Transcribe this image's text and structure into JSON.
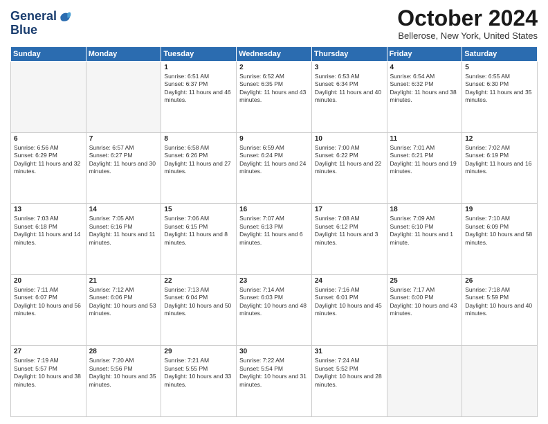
{
  "header": {
    "logo_line1": "General",
    "logo_line2": "Blue",
    "title": "October 2024",
    "location": "Bellerose, New York, United States"
  },
  "days_of_week": [
    "Sunday",
    "Monday",
    "Tuesday",
    "Wednesday",
    "Thursday",
    "Friday",
    "Saturday"
  ],
  "weeks": [
    [
      {
        "day": "",
        "empty": true
      },
      {
        "day": "",
        "empty": true
      },
      {
        "day": "1",
        "sunrise": "6:51 AM",
        "sunset": "6:37 PM",
        "daylight": "11 hours and 46 minutes."
      },
      {
        "day": "2",
        "sunrise": "6:52 AM",
        "sunset": "6:35 PM",
        "daylight": "11 hours and 43 minutes."
      },
      {
        "day": "3",
        "sunrise": "6:53 AM",
        "sunset": "6:34 PM",
        "daylight": "11 hours and 40 minutes."
      },
      {
        "day": "4",
        "sunrise": "6:54 AM",
        "sunset": "6:32 PM",
        "daylight": "11 hours and 38 minutes."
      },
      {
        "day": "5",
        "sunrise": "6:55 AM",
        "sunset": "6:30 PM",
        "daylight": "11 hours and 35 minutes."
      }
    ],
    [
      {
        "day": "6",
        "sunrise": "6:56 AM",
        "sunset": "6:29 PM",
        "daylight": "11 hours and 32 minutes."
      },
      {
        "day": "7",
        "sunrise": "6:57 AM",
        "sunset": "6:27 PM",
        "daylight": "11 hours and 30 minutes."
      },
      {
        "day": "8",
        "sunrise": "6:58 AM",
        "sunset": "6:26 PM",
        "daylight": "11 hours and 27 minutes."
      },
      {
        "day": "9",
        "sunrise": "6:59 AM",
        "sunset": "6:24 PM",
        "daylight": "11 hours and 24 minutes."
      },
      {
        "day": "10",
        "sunrise": "7:00 AM",
        "sunset": "6:22 PM",
        "daylight": "11 hours and 22 minutes."
      },
      {
        "day": "11",
        "sunrise": "7:01 AM",
        "sunset": "6:21 PM",
        "daylight": "11 hours and 19 minutes."
      },
      {
        "day": "12",
        "sunrise": "7:02 AM",
        "sunset": "6:19 PM",
        "daylight": "11 hours and 16 minutes."
      }
    ],
    [
      {
        "day": "13",
        "sunrise": "7:03 AM",
        "sunset": "6:18 PM",
        "daylight": "11 hours and 14 minutes."
      },
      {
        "day": "14",
        "sunrise": "7:05 AM",
        "sunset": "6:16 PM",
        "daylight": "11 hours and 11 minutes."
      },
      {
        "day": "15",
        "sunrise": "7:06 AM",
        "sunset": "6:15 PM",
        "daylight": "11 hours and 8 minutes."
      },
      {
        "day": "16",
        "sunrise": "7:07 AM",
        "sunset": "6:13 PM",
        "daylight": "11 hours and 6 minutes."
      },
      {
        "day": "17",
        "sunrise": "7:08 AM",
        "sunset": "6:12 PM",
        "daylight": "11 hours and 3 minutes."
      },
      {
        "day": "18",
        "sunrise": "7:09 AM",
        "sunset": "6:10 PM",
        "daylight": "11 hours and 1 minute."
      },
      {
        "day": "19",
        "sunrise": "7:10 AM",
        "sunset": "6:09 PM",
        "daylight": "10 hours and 58 minutes."
      }
    ],
    [
      {
        "day": "20",
        "sunrise": "7:11 AM",
        "sunset": "6:07 PM",
        "daylight": "10 hours and 56 minutes."
      },
      {
        "day": "21",
        "sunrise": "7:12 AM",
        "sunset": "6:06 PM",
        "daylight": "10 hours and 53 minutes."
      },
      {
        "day": "22",
        "sunrise": "7:13 AM",
        "sunset": "6:04 PM",
        "daylight": "10 hours and 50 minutes."
      },
      {
        "day": "23",
        "sunrise": "7:14 AM",
        "sunset": "6:03 PM",
        "daylight": "10 hours and 48 minutes."
      },
      {
        "day": "24",
        "sunrise": "7:16 AM",
        "sunset": "6:01 PM",
        "daylight": "10 hours and 45 minutes."
      },
      {
        "day": "25",
        "sunrise": "7:17 AM",
        "sunset": "6:00 PM",
        "daylight": "10 hours and 43 minutes."
      },
      {
        "day": "26",
        "sunrise": "7:18 AM",
        "sunset": "5:59 PM",
        "daylight": "10 hours and 40 minutes."
      }
    ],
    [
      {
        "day": "27",
        "sunrise": "7:19 AM",
        "sunset": "5:57 PM",
        "daylight": "10 hours and 38 minutes."
      },
      {
        "day": "28",
        "sunrise": "7:20 AM",
        "sunset": "5:56 PM",
        "daylight": "10 hours and 35 minutes."
      },
      {
        "day": "29",
        "sunrise": "7:21 AM",
        "sunset": "5:55 PM",
        "daylight": "10 hours and 33 minutes."
      },
      {
        "day": "30",
        "sunrise": "7:22 AM",
        "sunset": "5:54 PM",
        "daylight": "10 hours and 31 minutes."
      },
      {
        "day": "31",
        "sunrise": "7:24 AM",
        "sunset": "5:52 PM",
        "daylight": "10 hours and 28 minutes."
      },
      {
        "day": "",
        "empty": true
      },
      {
        "day": "",
        "empty": true
      }
    ]
  ],
  "labels": {
    "sunrise_prefix": "Sunrise: ",
    "sunset_prefix": "Sunset: ",
    "daylight_prefix": "Daylight: "
  }
}
